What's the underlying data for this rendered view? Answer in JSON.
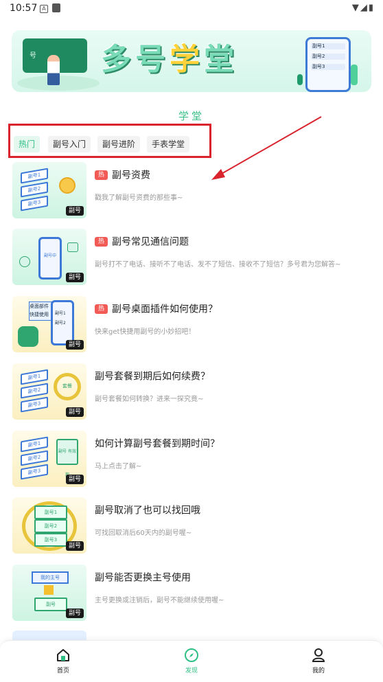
{
  "status_bar": {
    "time": "10:57",
    "app_icon_a": "A",
    "signal_icons": "▼◢▮"
  },
  "banner": {
    "title_part1": "多",
    "title_part2": "号",
    "title_part3": "学",
    "title_part4": "堂",
    "board_text": "号",
    "tablet_rows": [
      "副号1",
      "副号2",
      "副号3"
    ]
  },
  "section_title": "学堂",
  "tabs": [
    {
      "label": "热门",
      "active": true
    },
    {
      "label": "副号入门",
      "active": false
    },
    {
      "label": "副号进阶",
      "active": false
    },
    {
      "label": "手表学堂",
      "active": false
    }
  ],
  "articles": [
    {
      "title": "副号资费",
      "subtitle": "戳我了解副号资费的那些事~",
      "hot": true,
      "hot_label": "热",
      "badge": "副号",
      "theme": "g",
      "thumb_text": [
        "副号1",
        "副号2",
        "副号3"
      ]
    },
    {
      "title": "副号常见通信问题",
      "subtitle": "副号打不了电话、接听不了电话、发不了短信、接收不了短信？多号君为您解答~",
      "hot": true,
      "hot_label": "热",
      "badge": "副号",
      "theme": "g",
      "thumb_text": [
        "副号中"
      ]
    },
    {
      "title": "副号桌面插件如何使用？",
      "subtitle": "快来get快捷用副号的小妙招吧！",
      "hot": true,
      "hot_label": "热",
      "badge": "副号",
      "theme": "y",
      "thumb_text": [
        "桌面部件",
        "快捷使用",
        "副号1",
        "副号2"
      ]
    },
    {
      "title": "副号套餐到期后如何续费？",
      "subtitle": "副号套餐如何转换？进来一探究竟~",
      "hot": false,
      "hot_label": "",
      "badge": "副号",
      "theme": "y",
      "thumb_text": [
        "副号1",
        "副号2",
        "副号3",
        "套餐"
      ]
    },
    {
      "title": "如何计算副号套餐到期时间？",
      "subtitle": "马上点击了解~",
      "hot": false,
      "hot_label": "",
      "badge": "副号",
      "theme": "y",
      "thumb_text": [
        "副号1",
        "副号2",
        "副号3",
        "副号 有效期"
      ]
    },
    {
      "title": "副号取消了也可以找回哦",
      "subtitle": "可找回取消后60天内的副号喔~",
      "hot": false,
      "hot_label": "",
      "badge": "副号",
      "theme": "y",
      "thumb_text": [
        "副号1",
        "副号2",
        "副号3"
      ]
    },
    {
      "title": "副号能否更换主号使用",
      "subtitle": "主号更换或注销后，副号不能继续使用喔~",
      "hot": false,
      "hot_label": "",
      "badge": "副号",
      "theme": "g",
      "thumb_text": [
        "我的主号",
        "副号"
      ]
    }
  ],
  "bottom_nav": [
    {
      "label": "首页",
      "icon": "home-icon",
      "active": false
    },
    {
      "label": "发现",
      "icon": "compass-icon",
      "active": true
    },
    {
      "label": "我的",
      "icon": "person-icon",
      "active": false
    }
  ],
  "colors": {
    "accent": "#2fbf85",
    "hot": "#f25a55",
    "annotation": "#d9232d"
  }
}
